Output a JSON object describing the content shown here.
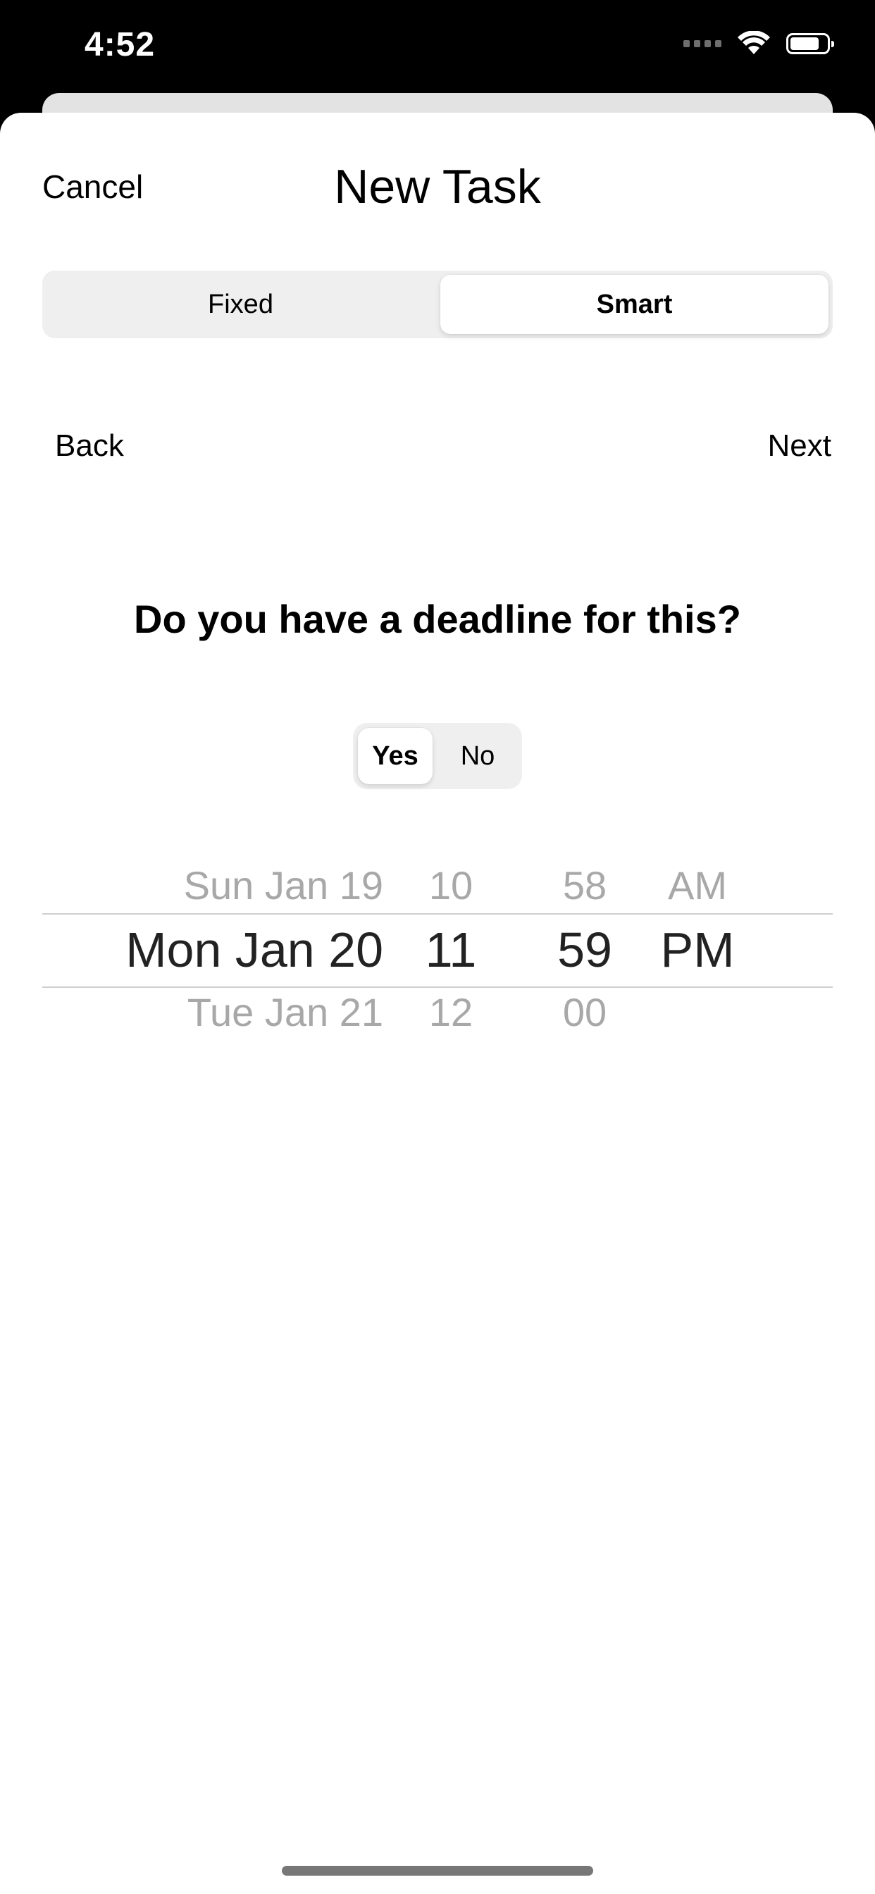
{
  "status_bar": {
    "time": "4:52"
  },
  "header": {
    "cancel_label": "Cancel",
    "title": "New Task"
  },
  "mode_segment": {
    "options": [
      "Fixed",
      "Smart"
    ],
    "selected": "Smart"
  },
  "nav": {
    "back_label": "Back",
    "next_label": "Next"
  },
  "question": "Do you have a deadline for this?",
  "deadline_toggle": {
    "options": [
      "Yes",
      "No"
    ],
    "selected": "Yes"
  },
  "picker": {
    "date": {
      "above": "Sun Jan 19",
      "selected": "Mon Jan 20",
      "below": "Tue Jan 21"
    },
    "hour": {
      "above": "10",
      "selected": "11",
      "below": "12"
    },
    "minute": {
      "above": "58",
      "selected": "59",
      "below": "00"
    },
    "ampm": {
      "above": "AM",
      "selected": "PM"
    }
  },
  "colors": {
    "background": "#ffffff",
    "segment_bg": "#efefef",
    "text": "#000000",
    "picker_dim": "#a8a8a8"
  }
}
